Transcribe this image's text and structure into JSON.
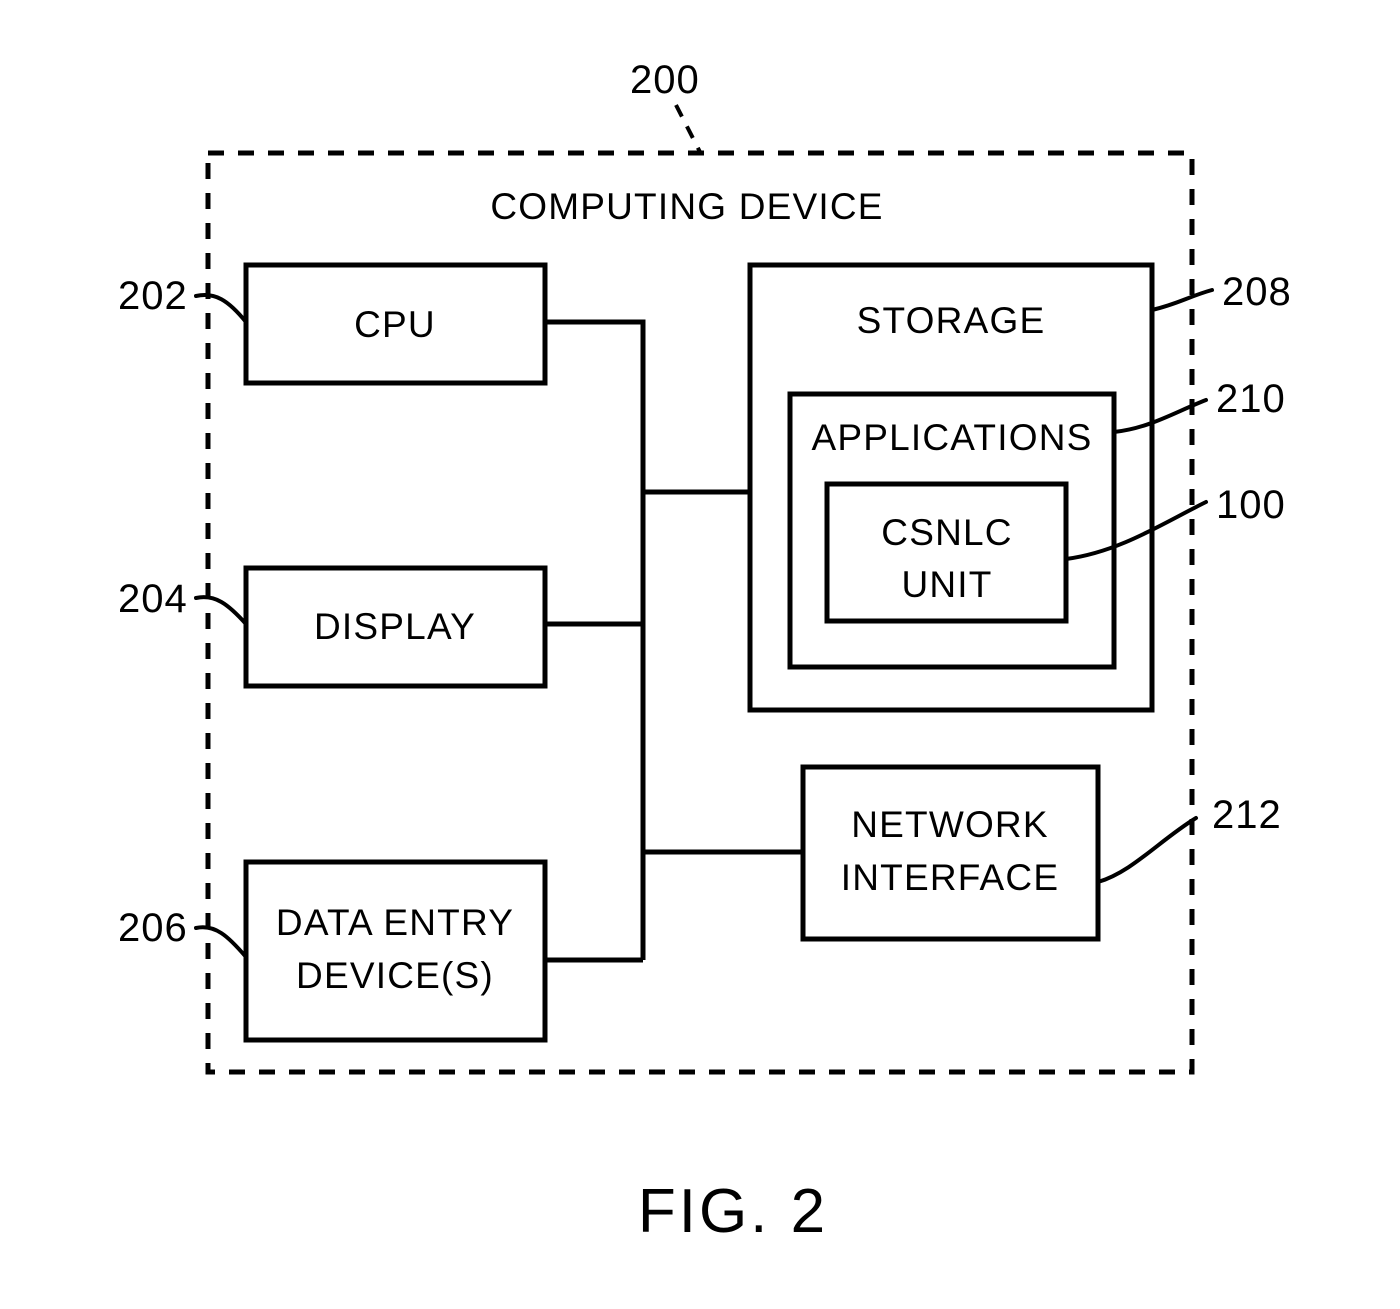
{
  "figure": {
    "caption": "FIG. 2",
    "title": "COMPUTING DEVICE",
    "title_ref": "200"
  },
  "blocks": [
    {
      "id": "cpu",
      "label": "CPU",
      "ref": "202",
      "lines": [
        "CPU"
      ]
    },
    {
      "id": "display",
      "label": "DISPLAY",
      "ref": "204",
      "lines": [
        "DISPLAY"
      ]
    },
    {
      "id": "data-entry",
      "label": "DATA ENTRY DEVICE(S)",
      "ref": "206",
      "lines": [
        "DATA ENTRY",
        "DEVICE(S)"
      ]
    },
    {
      "id": "storage",
      "label": "STORAGE",
      "ref": "208",
      "lines": [
        "STORAGE"
      ]
    },
    {
      "id": "applications",
      "label": "APPLICATIONS",
      "ref": "210",
      "lines": [
        "APPLICATIONS"
      ]
    },
    {
      "id": "csnlc-unit",
      "label": "CSNLC UNIT",
      "ref": "100",
      "lines": [
        "CSNLC",
        "UNIT"
      ]
    },
    {
      "id": "network-interface",
      "label": "NETWORK INTERFACE",
      "ref": "212",
      "lines": [
        "NETWORK",
        "INTERFACE"
      ]
    }
  ],
  "refs": {
    "cpu": "202",
    "display": "204",
    "data_entry": "206",
    "storage": "208",
    "applications": "210",
    "csnlc_unit": "100",
    "network_interface": "212",
    "computing_device": "200"
  },
  "text": {
    "computing_device": "COMPUTING DEVICE",
    "cpu": "CPU",
    "display": "DISPLAY",
    "data_entry_l1": "DATA ENTRY",
    "data_entry_l2": "DEVICE(S)",
    "storage": "STORAGE",
    "applications": "APPLICATIONS",
    "csnlc_l1": "CSNLC",
    "csnlc_l2": "UNIT",
    "network_l1": "NETWORK",
    "network_l2": "INTERFACE",
    "fig_caption": "FIG. 2"
  },
  "colors": {
    "ink": "#000000",
    "background": "#ffffff"
  }
}
